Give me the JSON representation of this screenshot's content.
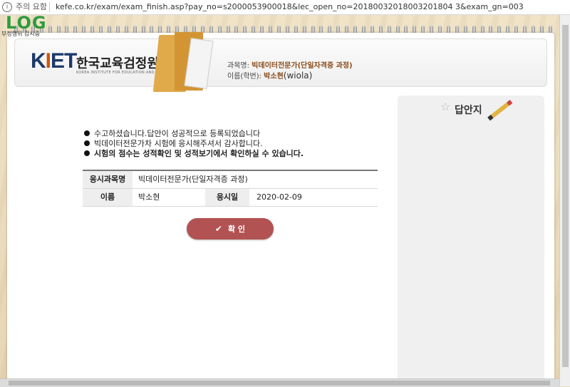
{
  "address_bar": {
    "warning": "주의 요함",
    "url": "kefe.co.kr/exam/exam_finish.asp?pay_no=s2000053900018&lec_open_no=20180032018003201804 3&exam_gn=003"
  },
  "overlay_logo": {
    "text": "LOG",
    "subtext": "부정행위 감시중"
  },
  "brand": {
    "logo_mark": "KIET",
    "name_kr": "한국교육검정원",
    "name_en": "KOREA INSTITUTE FOR EDUCATION AND TEST"
  },
  "exam_info": {
    "subject_label": "과목명:",
    "subject_value": "빅데이터전문가(단일자격증 과정)",
    "student_label": "이름(학번):",
    "student_name": "박소현",
    "student_id": "(wiola)"
  },
  "messages": [
    "수고하셨습니다.답안이 성공적으로 등록되었습니다",
    "빅데이터전문가차 시험에 응시해주셔서 감사합니다.",
    "시험의 점수는 성적확인 및 성적보기에서 확인하실 수 있습니다."
  ],
  "result_table": {
    "subject_label": "응시과목명",
    "subject_value": "빅데이터전문가(단일자격증 과정)",
    "name_label": "이름",
    "name_value": "박소현",
    "date_label": "응시일",
    "date_value": "2020-02-09"
  },
  "confirm_button": {
    "label": "확 인",
    "icon": "check-icon"
  },
  "answer_sheet": {
    "title": "답안지",
    "icons": [
      "star-icon",
      "pencil-icon"
    ]
  },
  "colors": {
    "button": "#b25252",
    "logo_green": "#2f9b3d",
    "brand_navy": "#1b3a6b",
    "accent_brown": "#8a4b1a"
  }
}
